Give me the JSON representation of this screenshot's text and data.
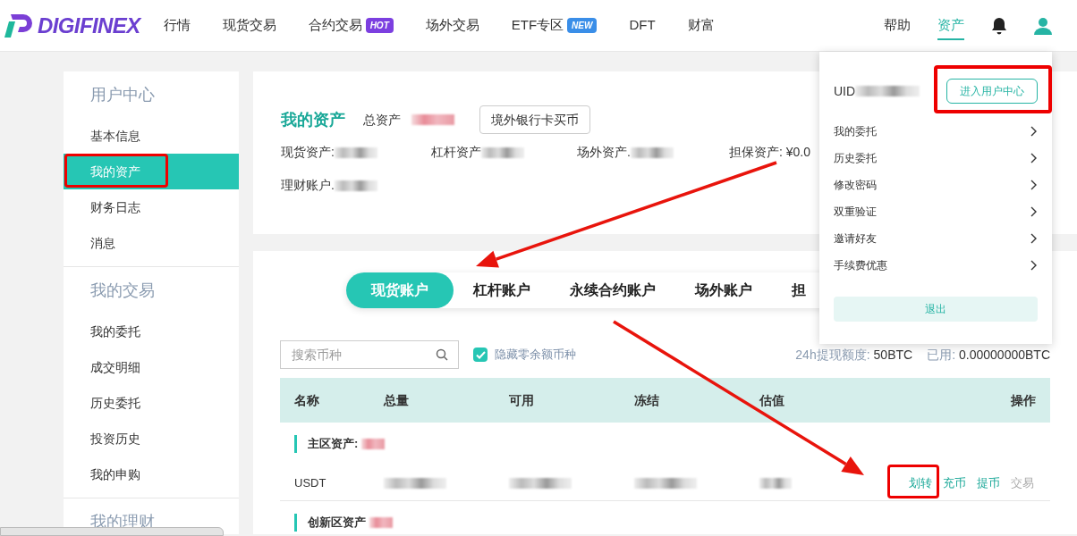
{
  "header": {
    "logo": "DIGIFINEX",
    "nav": [
      {
        "label": "行情"
      },
      {
        "label": "现货交易"
      },
      {
        "label": "合约交易",
        "badge": "HOT",
        "color": "#7c3fe0"
      },
      {
        "label": "场外交易"
      },
      {
        "label": "ETF专区",
        "badge": "NEW",
        "color": "#3a8ee8"
      },
      {
        "label": "DFT"
      },
      {
        "label": "财富"
      }
    ],
    "right": [
      {
        "label": "帮助",
        "selected": false
      },
      {
        "label": "资产",
        "selected": true
      }
    ]
  },
  "sidebar": {
    "groups": [
      {
        "title": "用户中心",
        "items": [
          {
            "label": "基本信息",
            "selected": false,
            "highlighted": false
          },
          {
            "label": "我的资产",
            "selected": true,
            "highlighted": true
          },
          {
            "label": "财务日志",
            "selected": false,
            "highlighted": false
          },
          {
            "label": "消息",
            "selected": false,
            "highlighted": false
          }
        ]
      },
      {
        "title": "我的交易",
        "items": [
          {
            "label": "我的委托",
            "selected": false,
            "highlighted": false
          },
          {
            "label": "成交明细",
            "selected": false,
            "highlighted": false
          },
          {
            "label": "历史委托",
            "selected": false,
            "highlighted": false
          },
          {
            "label": "投资历史",
            "selected": false,
            "highlighted": false
          },
          {
            "label": "我的申购",
            "selected": false,
            "highlighted": false
          }
        ]
      },
      {
        "title": "我的理财"
      }
    ]
  },
  "summary": {
    "title": "我的资产",
    "total_label": "总资产",
    "buy_button": "境外银行卡买币",
    "fields": [
      {
        "label": "现货资产:",
        "masked": true
      },
      {
        "label": "杠杆资产",
        "masked": true
      },
      {
        "label": "场外资产.",
        "masked": true
      },
      {
        "label": "担保资产: ¥0.0",
        "masked": false
      },
      {
        "label": "理财账户.",
        "masked": true
      }
    ]
  },
  "account_tabs": [
    {
      "label": "现货账户",
      "selected": true
    },
    {
      "label": "杠杆账户",
      "selected": false
    },
    {
      "label": "永续合约账户",
      "selected": false
    },
    {
      "label": "场外账户",
      "selected": false
    },
    {
      "label": "担",
      "selected": false
    }
  ],
  "toolbar": {
    "search_placeholder": "搜索币种",
    "hide_zero": {
      "label": "隐藏零余额币种",
      "checked": true
    },
    "limit_label": "24h提现额度:",
    "limit_value": "50BTC",
    "used_label": "已用:",
    "used_value": "0.00000000BTC"
  },
  "table": {
    "columns": [
      "名称",
      "总量",
      "可用",
      "冻结",
      "估值",
      "操作"
    ],
    "sections": [
      {
        "title": "主区资产:",
        "rows": [
          {
            "name": "USDT",
            "actions": [
              {
                "label": "划转",
                "enabled": true,
                "highlighted": true
              },
              {
                "label": "充币",
                "enabled": true,
                "highlighted": false
              },
              {
                "label": "提币",
                "enabled": true,
                "highlighted": false
              },
              {
                "label": "交易",
                "enabled": false,
                "highlighted": false
              }
            ]
          }
        ]
      },
      {
        "title": "创新区资产"
      }
    ]
  },
  "user_menu": {
    "uid_label": "UID",
    "center_button": "进入用户中心",
    "center_highlighted": true,
    "items": [
      "我的委托",
      "历史委托",
      "修改密码",
      "双重验证",
      "邀请好友",
      "手续费优惠"
    ],
    "logout": "退出"
  }
}
